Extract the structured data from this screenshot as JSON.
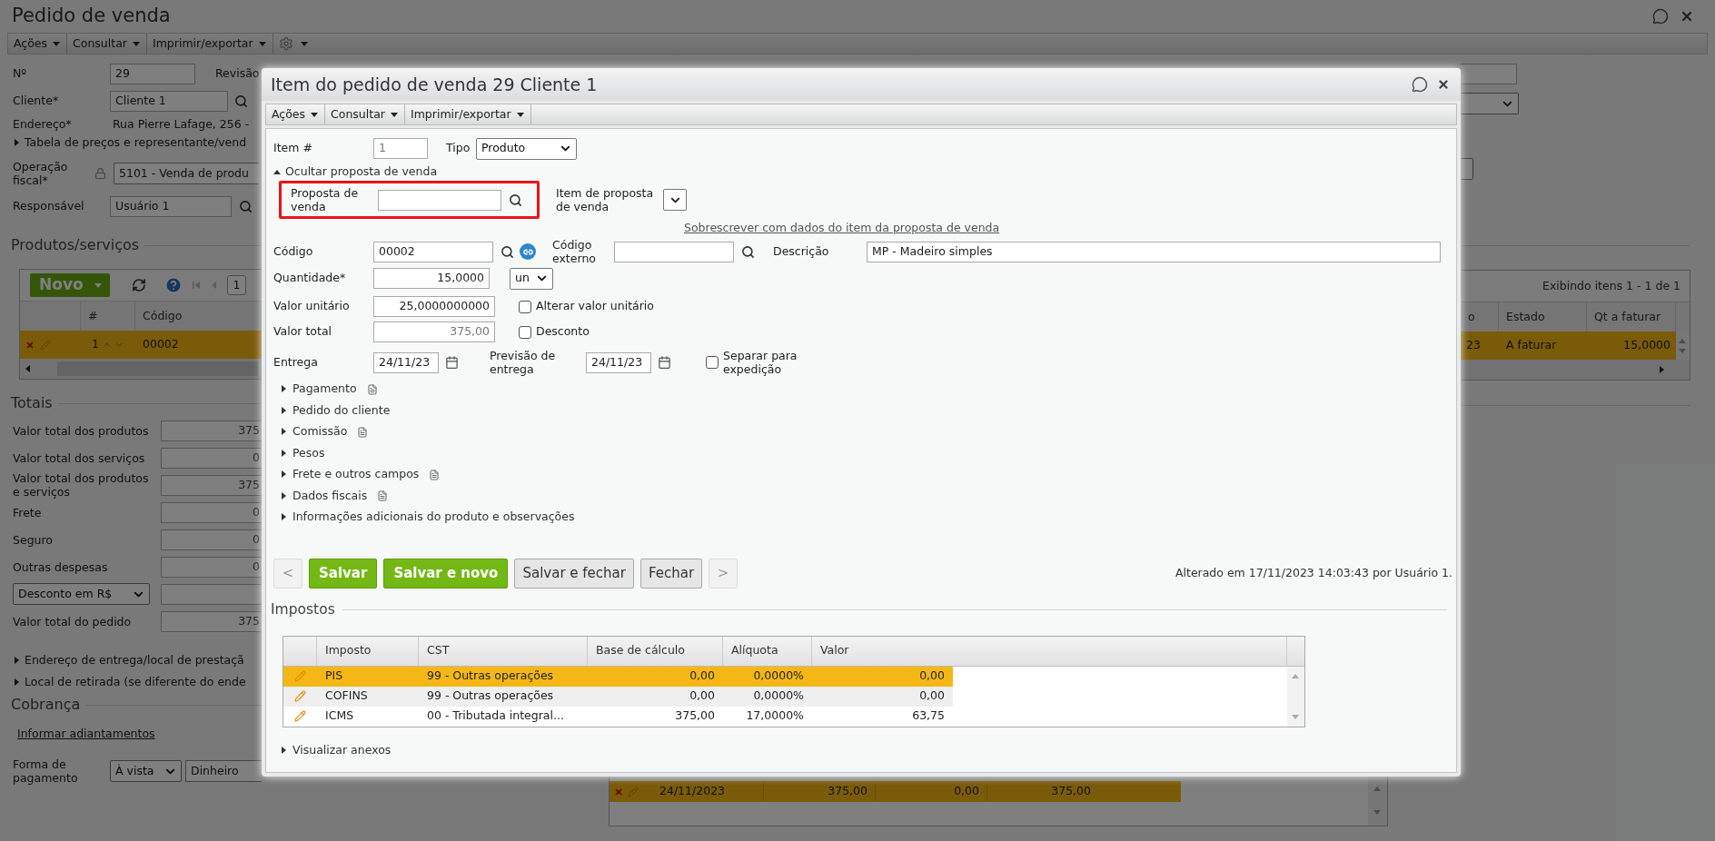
{
  "page": {
    "title": "Pedido de venda",
    "menus": [
      "Ações",
      "Consultar",
      "Imprimir/exportar"
    ],
    "numero": {
      "label": "Nº",
      "value": "29"
    },
    "revisao_label": "Revisão",
    "cliente": {
      "label": "Cliente*",
      "value": "Cliente 1"
    },
    "endereco": {
      "label": "Endereço*",
      "value": "Rua Pierre Lafage, 256 -"
    },
    "tabela_toggle": "Tabela de preços e representante/vend",
    "operacao": {
      "label": "Operação fiscal*",
      "value": "5101 - Venda de produ"
    },
    "responsavel": {
      "label": "Responsável",
      "value": "Usuário 1"
    },
    "products": {
      "title": "Produtos/serviços",
      "new_button": "Novo",
      "page": "1",
      "summary": "Exibindo itens 1 - 1 de 1",
      "columns_left": [
        "#",
        "Código"
      ],
      "columns_right": [
        "o",
        "Estado",
        "Qt a faturar"
      ],
      "row": {
        "num": "1",
        "codigo": "00002",
        "right_cells": [
          "23",
          "A faturar",
          "15,0000"
        ],
        "selected": true
      }
    },
    "totals": {
      "title": "Totais",
      "rows": [
        {
          "kind": "label",
          "label": "Valor total dos produtos",
          "value": "375"
        },
        {
          "kind": "label",
          "label": "Valor total dos serviços",
          "value": "0"
        },
        {
          "kind": "label",
          "label": "Valor total dos produtos e serviços",
          "value": "375"
        },
        {
          "kind": "label",
          "label": "Frete",
          "value": "0"
        },
        {
          "kind": "label",
          "label": "Seguro",
          "value": "0"
        },
        {
          "kind": "label",
          "label": "Outras despesas",
          "value": "0"
        },
        {
          "kind": "select",
          "label": "Desconto em R$"
        },
        {
          "kind": "label",
          "label": "Valor total do pedido",
          "value": "375"
        }
      ]
    },
    "toggles": [
      "Endereço de entrega/local de prestaçã",
      "Local de retirada (se diferente do ende"
    ],
    "cobranca": {
      "title": "Cobrança",
      "link": "Informar adiantamentos",
      "forma_label": "Forma de pagamento",
      "forma_value": "À vista",
      "meio": "Dinheiro"
    },
    "installment": {
      "date": "24/11/2023",
      "values": [
        "375,00",
        "0,00",
        "375,00"
      ],
      "selected": true
    }
  },
  "dialog": {
    "title": "Item do pedido de venda 29 Cliente 1",
    "menus": [
      "Ações",
      "Consultar",
      "Imprimir/exportar"
    ],
    "item": {
      "label": "Item #",
      "value": "1"
    },
    "tipo": {
      "label": "Tipo",
      "value": "Produto"
    },
    "proposal_toggle": "Ocultar proposta de venda",
    "proposta": {
      "label": "Proposta de venda"
    },
    "item_proposta": {
      "label": "Item de proposta de venda"
    },
    "overwrite_link": "Sobrescrever com dados do item da proposta de venda",
    "codigo": {
      "label": "Código",
      "value": "00002"
    },
    "codigo_externo": {
      "label": "Código externo"
    },
    "descricao": {
      "label": "Descrição",
      "value": "MP - Madeiro simples"
    },
    "quantidade": {
      "label": "Quantidade*",
      "value": "15,0000",
      "unit": "un"
    },
    "valor_unitario": {
      "label": "Valor unitário",
      "value": "25,0000000000",
      "checkbox": {
        "label": "Alterar valor unitário",
        "checked": false
      }
    },
    "valor_total": {
      "label": "Valor total",
      "value": "375,00",
      "checkbox": {
        "label": "Desconto",
        "checked": false
      }
    },
    "entrega": {
      "label": "Entrega",
      "value": "24/11/23"
    },
    "previsao": {
      "label": "Previsão de entrega",
      "value": "24/11/23"
    },
    "separar": {
      "label": "Separar para expedição",
      "checked": false
    },
    "sections": [
      {
        "label": "Pagamento",
        "note": true
      },
      {
        "label": "Pedido do cliente",
        "note": false
      },
      {
        "label": "Comissão",
        "note": true
      },
      {
        "label": "Pesos",
        "note": false
      },
      {
        "label": "Frete e outros campos",
        "note": true
      },
      {
        "label": "Dados fiscais",
        "note": true
      },
      {
        "label": "Informações adicionais do produto e observações",
        "note": false
      }
    ],
    "buttons": [
      {
        "label": "<",
        "kind": "nav",
        "disabled": true
      },
      {
        "label": "Salvar",
        "kind": "primary",
        "disabled": false
      },
      {
        "label": "Salvar e novo",
        "kind": "primary",
        "disabled": false
      },
      {
        "label": "Salvar e fechar",
        "kind": "secondary",
        "disabled": false
      },
      {
        "label": "Fechar",
        "kind": "secondary",
        "disabled": false
      },
      {
        "label": ">",
        "kind": "nav",
        "disabled": true
      }
    ],
    "audit": "Alterado em 17/11/2023 14:03:43 por Usuário 1.",
    "taxes": {
      "title": "Impostos",
      "columns": [
        "Imposto",
        "CST",
        "Base de cálculo",
        "Alíquota",
        "Valor"
      ],
      "rows": [
        {
          "cells": [
            "PIS",
            "99 - Outras operações",
            "0,00",
            "0,0000%",
            "0,00"
          ],
          "selected": true
        },
        {
          "cells": [
            "COFINS",
            "99 - Outras operações",
            "0,00",
            "0,0000%",
            "0,00"
          ],
          "selected": false
        },
        {
          "cells": [
            "ICMS",
            "00 - Tributada integral...",
            "375,00",
            "17,0000%",
            "63,75"
          ],
          "selected": false
        }
      ]
    },
    "attachments_toggle": "Visualizar anexos"
  }
}
